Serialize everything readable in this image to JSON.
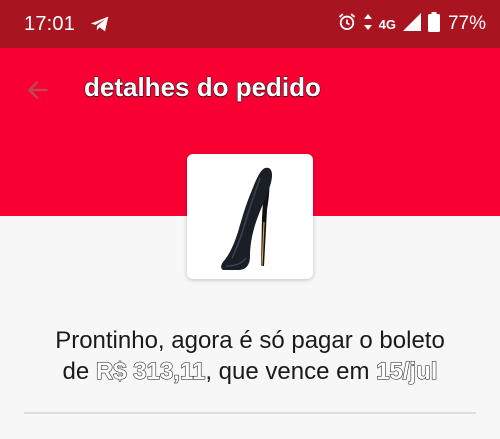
{
  "status_bar": {
    "time": "17:01",
    "network": "4G",
    "battery": "77%",
    "icons": [
      "telegram-icon",
      "alarm-icon",
      "data-arrows-icon",
      "signal-icon",
      "battery-icon"
    ]
  },
  "header": {
    "title": "detalhes do pedido",
    "back_icon": "arrow-left-icon"
  },
  "product": {
    "image": "black-high-heel-shoe"
  },
  "message": {
    "prefix_line1": "Prontinho, agora é só pagar o boleto",
    "prefix_line2": "de ",
    "amount": "R$ 313,11",
    "middle": ", que vence em ",
    "due_date": "15/jul"
  },
  "colors": {
    "status_bar": "#a8141f",
    "header": "#f80032",
    "background": "#f7f7f7"
  }
}
